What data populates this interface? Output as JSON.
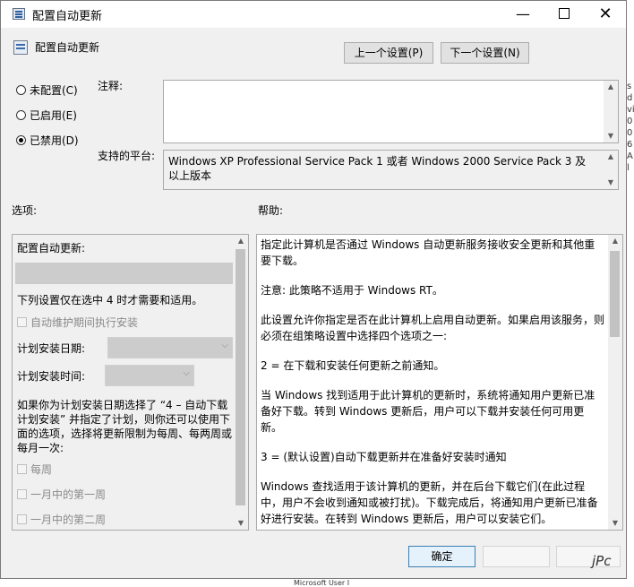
{
  "window": {
    "title": "配置自动更新",
    "minimize": "—",
    "close": "✕"
  },
  "header": {
    "title": "配置自动更新",
    "prev_button": "上一个设置(P)",
    "next_button": "下一个设置(N)"
  },
  "state": {
    "options": [
      {
        "label": "未配置(C)",
        "selected": false
      },
      {
        "label": "已启用(E)",
        "selected": false
      },
      {
        "label": "已禁用(D)",
        "selected": true
      }
    ]
  },
  "comment": {
    "label": "注释:",
    "value": ""
  },
  "platform": {
    "label": "支持的平台:",
    "text": "Windows XP Professional Service Pack 1 或者 Windows 2000 Service Pack 3 及以上版本"
  },
  "options_panel": {
    "header": "选项:",
    "title": "配置自动更新:",
    "note": "下列设置仅在选中 4 时才需要和适用。",
    "maintenance_checkbox": "自动维护期间执行安装",
    "schedule_day_label": "计划安装日期:",
    "schedule_time_label": "计划安装时间:",
    "description": [
      "如果你为计划安装日期选择了 “4 – 自动下载",
      "计划安装” 并指定了计划，则你还可以使用下",
      "面的选项，选择将更新限制为每周、每两周或",
      "每月一次:"
    ],
    "weekly": "每周",
    "first_week": "一月中的第一周",
    "second_week": "一月中的第二周"
  },
  "help_panel": {
    "header": "帮助:",
    "paragraphs": [
      "指定此计算机是否通过 Windows 自动更新服务接收安全更新和其他重要下载。",
      "注意: 此策略不适用于 Windows RT。",
      "此设置允许你指定是否在此计算机上启用自动更新。如果启用该服务，则必须在组策略设置中选择四个选项之一:",
      " 2 = 在下载和安装任何更新之前通知。",
      " 当 Windows 找到适用于此计算机的更新时，系统将通知用户更新已准备好下载。转到 Windows 更新后，用户可以下载并安装任何可用更新。",
      " 3 = (默认设置)自动下载更新并在准备好安装时通知",
      " Windows 查找适用于该计算机的更新，并在后台下载它们(在此过程中，用户不会收到通知或被打扰)。下载完成后，将通知用户更新已准备好进行安装。在转到 Windows 更新后，用户可以安装它们。"
    ]
  },
  "footer": {
    "ok_button": "确定",
    "watermark": "jPc"
  },
  "background": {
    "strip": [
      "s",
      "d",
      "vi",
      "0",
      "0",
      "",
      "6",
      "",
      "",
      "",
      "A",
      "",
      "",
      "",
      "",
      "l"
    ],
    "taskbar_item": "Microsoft User I"
  }
}
